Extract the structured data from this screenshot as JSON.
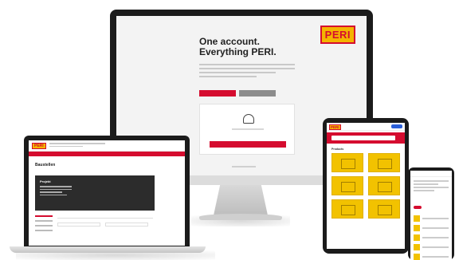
{
  "brand": {
    "logo_text": "PERI",
    "accent_red": "#d50c2f",
    "accent_yellow": "#f4b400"
  },
  "desktop": {
    "headline_line1": "One account.",
    "headline_line2": "Everything PERI."
  },
  "laptop": {
    "logo_text": "PERI",
    "heading": "Baustellen",
    "banner_name": "Projekt"
  },
  "tablet": {
    "logo_text": "PERI",
    "section_label": "Products"
  }
}
